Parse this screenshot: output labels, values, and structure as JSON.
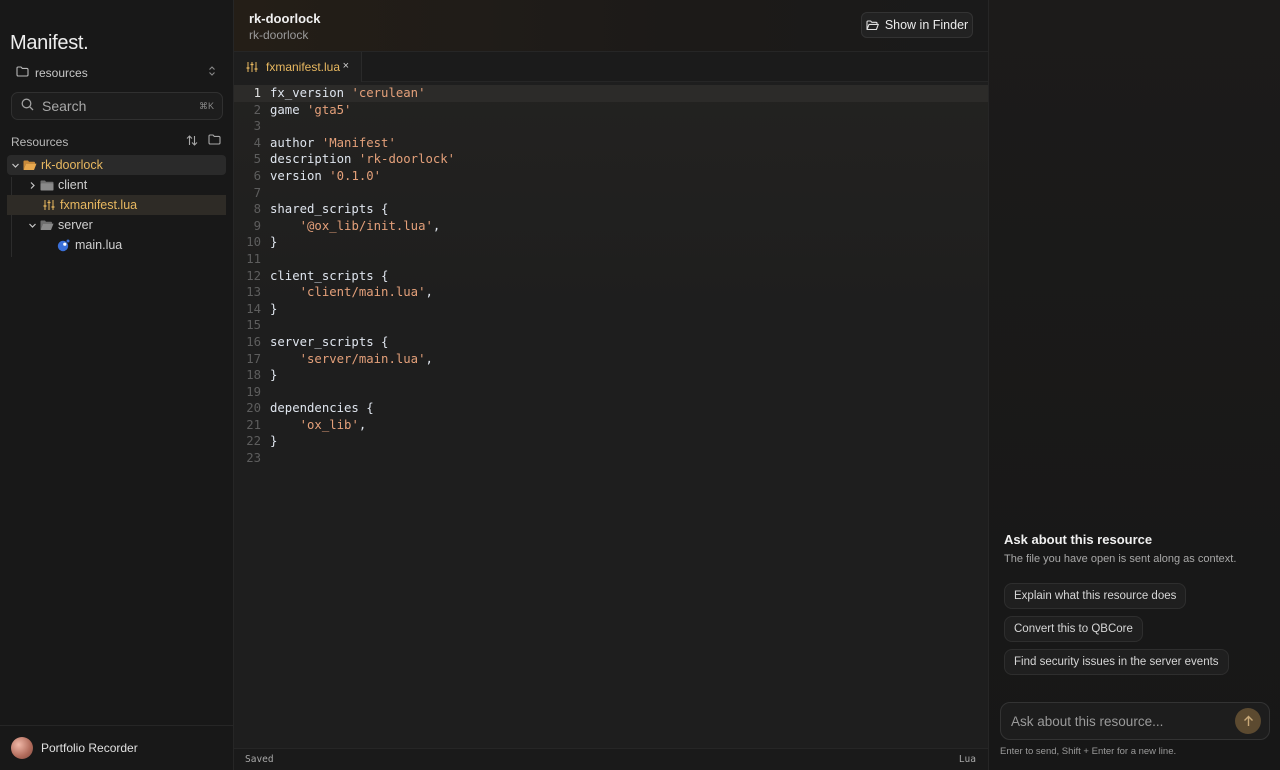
{
  "sidebar": {
    "logo": "Manifest.",
    "workspace": "resources",
    "search": {
      "placeholder": "Search",
      "shortcut": "⌘K"
    },
    "resources_label": "Resources",
    "tree": {
      "root": "rk-doorlock",
      "client": "client",
      "manifest": "fxmanifest.lua",
      "server": "server",
      "main": "main.lua"
    },
    "user": {
      "name": "Portfolio Recorder"
    }
  },
  "editor": {
    "title": "rk-doorlock",
    "subtitle": "rk-doorlock",
    "finder_button": "Show in Finder",
    "tab_label": "fxmanifest.lua",
    "tab_close": "×",
    "current_line": 1,
    "lines": [
      {
        "n": "1",
        "parts": [
          [
            "fx_version ",
            "k"
          ],
          [
            "'cerulean'",
            "s"
          ]
        ]
      },
      {
        "n": "2",
        "parts": [
          [
            "game ",
            "k"
          ],
          [
            "'gta5'",
            "s"
          ]
        ]
      },
      {
        "n": "3",
        "parts": []
      },
      {
        "n": "4",
        "parts": [
          [
            "author ",
            "k"
          ],
          [
            "'Manifest'",
            "s"
          ]
        ]
      },
      {
        "n": "5",
        "parts": [
          [
            "description ",
            "k"
          ],
          [
            "'rk-doorlock'",
            "s"
          ]
        ]
      },
      {
        "n": "6",
        "parts": [
          [
            "version ",
            "k"
          ],
          [
            "'0.1.0'",
            "s"
          ]
        ]
      },
      {
        "n": "7",
        "parts": []
      },
      {
        "n": "8",
        "parts": [
          [
            "shared_scripts {",
            "k"
          ]
        ]
      },
      {
        "n": "9",
        "parts": [
          [
            "    ",
            "k"
          ],
          [
            "'@ox_lib/init.lua'",
            "s"
          ],
          [
            ",",
            "k"
          ]
        ]
      },
      {
        "n": "10",
        "parts": [
          [
            "}",
            "k"
          ]
        ]
      },
      {
        "n": "11",
        "parts": []
      },
      {
        "n": "12",
        "parts": [
          [
            "client_scripts {",
            "k"
          ]
        ]
      },
      {
        "n": "13",
        "parts": [
          [
            "    ",
            "k"
          ],
          [
            "'client/main.lua'",
            "s"
          ],
          [
            ",",
            "k"
          ]
        ]
      },
      {
        "n": "14",
        "parts": [
          [
            "}",
            "k"
          ]
        ]
      },
      {
        "n": "15",
        "parts": []
      },
      {
        "n": "16",
        "parts": [
          [
            "server_scripts {",
            "k"
          ]
        ]
      },
      {
        "n": "17",
        "parts": [
          [
            "    ",
            "k"
          ],
          [
            "'server/main.lua'",
            "s"
          ],
          [
            ",",
            "k"
          ]
        ]
      },
      {
        "n": "18",
        "parts": [
          [
            "}",
            "k"
          ]
        ]
      },
      {
        "n": "19",
        "parts": []
      },
      {
        "n": "20",
        "parts": [
          [
            "dependencies {",
            "k"
          ]
        ]
      },
      {
        "n": "21",
        "parts": [
          [
            "    ",
            "k"
          ],
          [
            "'ox_lib'",
            "s"
          ],
          [
            ",",
            "k"
          ]
        ]
      },
      {
        "n": "22",
        "parts": [
          [
            "}",
            "k"
          ]
        ]
      },
      {
        "n": "23",
        "parts": []
      }
    ],
    "status_left": "Saved",
    "status_right": "Lua"
  },
  "assistant": {
    "title": "Ask about this resource",
    "subtitle": "The file you have open is sent along as context.",
    "suggestions": [
      "Explain what this resource does",
      "Convert this to QBCore",
      "Find security issues in the server events"
    ],
    "input_placeholder": "Ask about this resource...",
    "hint": "Enter to send, Shift + Enter for a new line."
  },
  "colors": {
    "accent": "#e8b860",
    "string": "#e4a07a",
    "code_text": "#dfe5ee"
  }
}
